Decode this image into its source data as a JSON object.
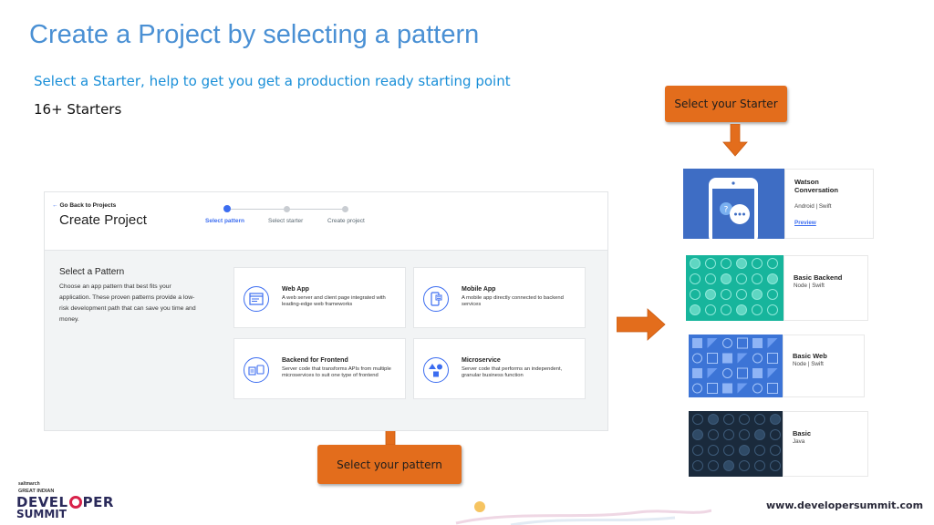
{
  "slide": {
    "title": "Create a Project by selecting a pattern",
    "subtitle": "Select a Starter, help to get you get a production ready starting point",
    "starter_count": "16+ Starters",
    "callout_starter": "Select your Starter",
    "callout_pattern": "Select your pattern",
    "accent_color": "#e36d1c",
    "title_color": "#4a90d4"
  },
  "screenshot": {
    "back_link": "Go Back to Projects",
    "title": "Create Project",
    "steps": [
      {
        "label": "Select pattern",
        "active": true
      },
      {
        "label": "Select starter",
        "active": false
      },
      {
        "label": "Create project",
        "active": false
      }
    ],
    "section_heading": "Select a Pattern",
    "section_desc": "Choose an app pattern that best fits your application. These proven patterns provide a low-risk development path that can save you time and money.",
    "patterns": [
      {
        "title": "Web App",
        "desc": "A web server and client page integrated with leading-edge web frameworks",
        "icon": "web-app-icon"
      },
      {
        "title": "Mobile App",
        "desc": "A mobile app directly connected to backend services",
        "icon": "mobile-app-icon"
      },
      {
        "title": "Backend for Frontend",
        "desc": "Server code that transforms APIs from multiple microservices to suit one type of frontend",
        "icon": "backend-for-frontend-icon"
      },
      {
        "title": "Microservice",
        "desc": "Server code that performs an independent, granular business function",
        "icon": "microservice-icon"
      }
    ]
  },
  "starters": [
    {
      "title": "Watson Conversation",
      "meta": "Android | Swift",
      "link": "Preview"
    },
    {
      "title": "Basic Backend",
      "meta": "Node | Swift"
    },
    {
      "title": "Basic Web",
      "meta": "Node | Swift"
    },
    {
      "title": "Basic",
      "meta": "Java"
    }
  ],
  "footer": {
    "logo_top": "saltmarch",
    "logo_line1": "GREAT INDIAN",
    "logo_line2": "DEVEL",
    "logo_line2b": "PER",
    "logo_line3": "SUMMIT",
    "url": "www.developersummit.com"
  }
}
